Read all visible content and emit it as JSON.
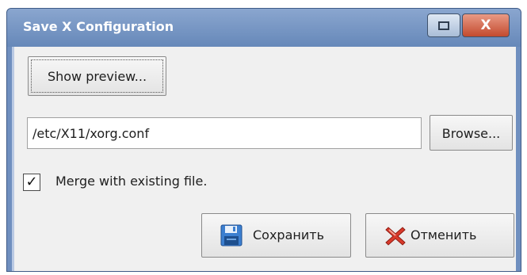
{
  "window": {
    "title": "Save X Configuration",
    "close_label": "X"
  },
  "preview_button": {
    "label": "Show preview..."
  },
  "path_field": {
    "value": "/etc/X11/xorg.conf"
  },
  "browse_button": {
    "label": "Browse..."
  },
  "merge_option": {
    "checked": true,
    "check_mark": "✓",
    "label": "Merge with existing file."
  },
  "actions": {
    "save_label": "Сохранить",
    "save_icon": "floppy-disk-icon",
    "cancel_label": "Отменить",
    "cancel_icon": "red-x-icon"
  },
  "colors": {
    "titlebar": "#7896c4",
    "close_button": "#d0654a",
    "client_area": "#f0f0f0"
  }
}
